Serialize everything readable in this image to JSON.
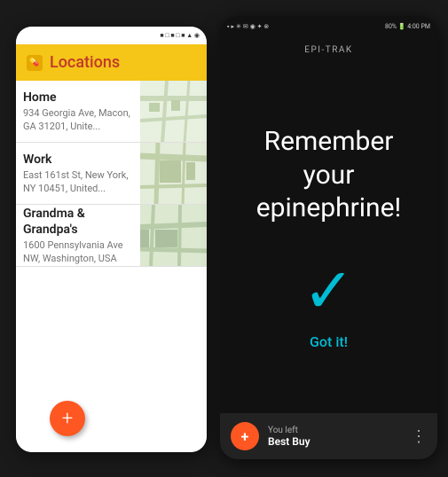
{
  "phoneLeft": {
    "statusIcons": "• • •",
    "header": {
      "title": "Locations",
      "iconLabel": "epi-icon"
    },
    "locations": [
      {
        "name": "Home",
        "address": "934 Georgia Ave, Macon, GA 31201, Unite..."
      },
      {
        "name": "Work",
        "address": "East 161st St, New York, NY 10451, United..."
      },
      {
        "name": "Grandma & Grandpa's",
        "address": "1600 Pennsylvania Ave NW, Washington, USA"
      }
    ],
    "fab": "+"
  },
  "phoneRight": {
    "statusBar": {
      "leftIcons": "📶 📶",
      "centerText": "",
      "rightText": "80% 🔋 4:00 PM"
    },
    "appName": "EPI-TRAK",
    "reminderText": "Remember your epinephrine!",
    "checkmarkLabel": "✓",
    "gotItLabel": "Got it!",
    "notification": {
      "iconLabel": "+",
      "line1": "You left",
      "line2": "Best Buy",
      "moreIcon": "⋮"
    }
  }
}
